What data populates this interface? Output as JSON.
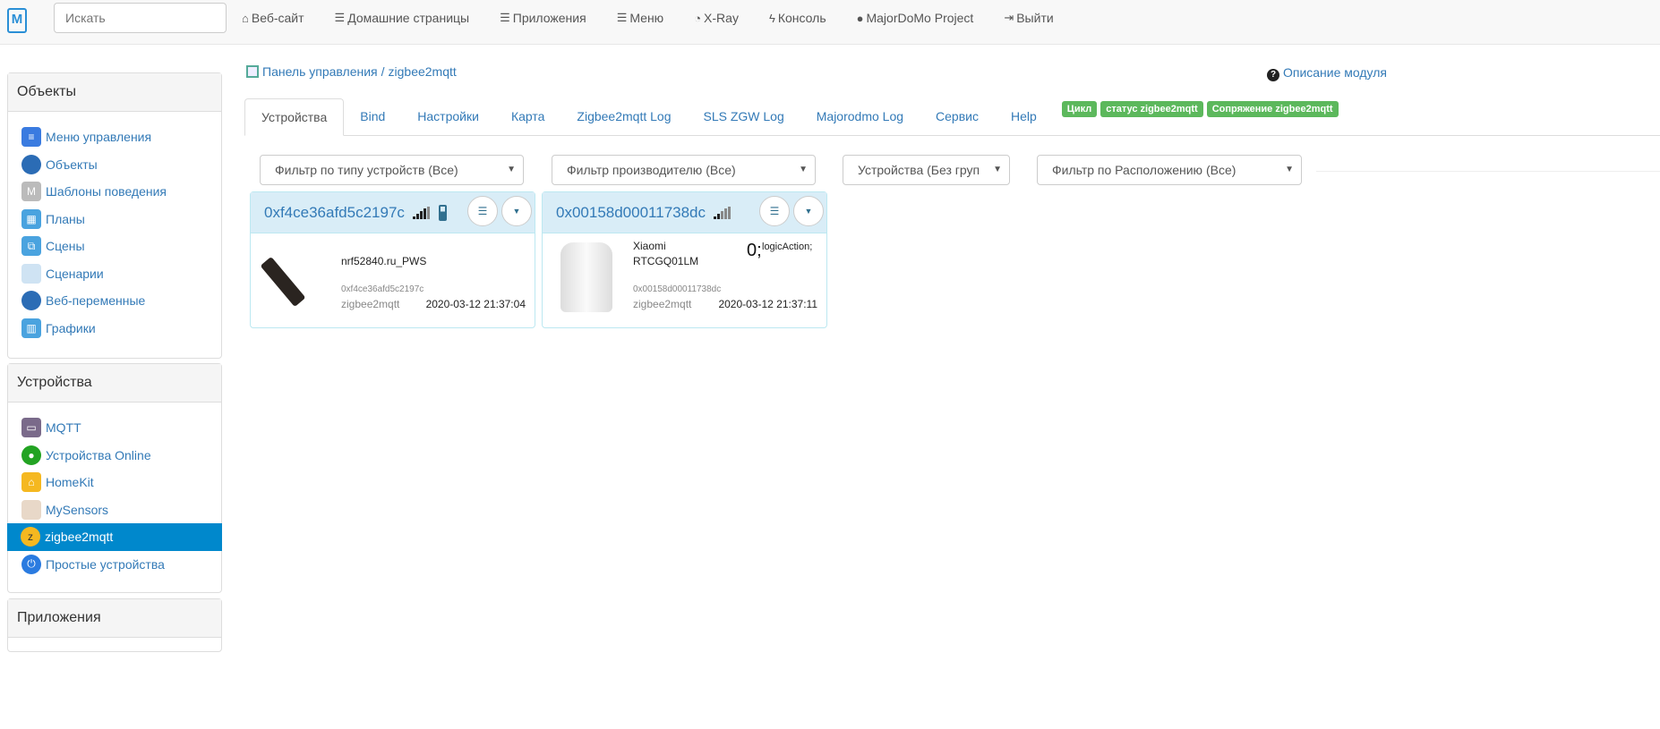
{
  "topbar": {
    "logo": "M",
    "search_placeholder": "Искать",
    "nav": [
      {
        "icon": "home-icon",
        "label": "Веб-сайт"
      },
      {
        "icon": "list-icon",
        "label": "Домашние страницы"
      },
      {
        "icon": "list-icon",
        "label": "Приложения"
      },
      {
        "icon": "list-icon",
        "label": "Меню"
      },
      {
        "icon": "dashboard-icon",
        "label": "X-Ray"
      },
      {
        "icon": "bolt-icon",
        "label": "Консоль"
      },
      {
        "icon": "globe-icon",
        "label": "MajorDoMo Project"
      },
      {
        "icon": "logout-icon",
        "label": "Выйти"
      }
    ]
  },
  "sidebar": {
    "objects": {
      "title": "Объекты",
      "items": [
        "Меню управления",
        "Объекты",
        "Шаблоны поведения",
        "Планы",
        "Сцены",
        "Сценарии",
        "Веб-переменные",
        "Графики"
      ]
    },
    "devices": {
      "title": "Устройства",
      "items": [
        "MQTT",
        "Устройства Online",
        "HomeKit",
        "MySensors",
        "zigbee2mqtt",
        "Простые устройства"
      ],
      "active": "zigbee2mqtt"
    },
    "apps": {
      "title": "Приложения"
    }
  },
  "breadcrumb": {
    "root": "Панель управления",
    "sep": "/",
    "current": "zigbee2mqtt"
  },
  "help_link": "Описание модуля",
  "tabs": [
    "Устройства",
    "Bind",
    "Настройки",
    "Карта",
    "Zigbee2mqtt Log",
    "SLS ZGW Log",
    "Majorodmo Log",
    "Сервис",
    "Help"
  ],
  "badges": [
    "Цикл",
    "статус zigbee2mqtt",
    "Сопряжение zigbee2mqtt"
  ],
  "filters": [
    "Фильтр по типу устройств (Все)",
    "Фильтр производителю (Все)",
    "Устройства (Без груп",
    "Фильтр по Расположению (Все)"
  ],
  "devices": [
    {
      "id": "0xf4ce36afd5c2197c",
      "name": "nrf52840.ru_PWS",
      "model": "",
      "sub_id": "0xf4ce36afd5c2197c",
      "source": "zigbee2mqtt",
      "updated": "2020-03-12 21:37:04"
    },
    {
      "id": "0x00158d00011738dc",
      "name": "Xiaomi",
      "model": "RTCGQ01LM",
      "value": "0;",
      "value_label": "logicAction;",
      "sub_id": "0x00158d00011738dc",
      "source": "zigbee2mqtt",
      "updated": "2020-03-12 21:37:11"
    }
  ]
}
